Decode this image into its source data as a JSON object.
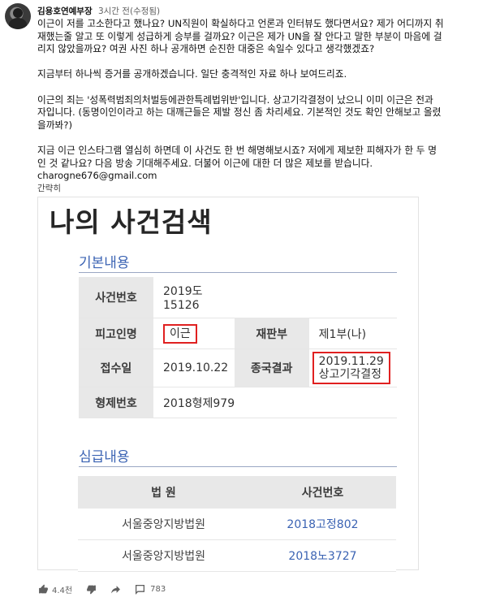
{
  "comment": {
    "author": "김용호연예부장",
    "time": "3시간 전(수정됨)",
    "paragraphs": [
      [
        "이근이 저를 고소한다고 했나요? UN직원이 확실하다고 언론과 인터뷰도 했다면서요? 제가 어디까지 취",
        "재했는줄 알고 또 이렇게 성급하게 승부를 걸까요? 이근은 제가 UN을 잘 안다고 말한 부분이 마음에 걸",
        "리지 않았을까요? 여권 사진 하나 공개하면 순진한 대중은 속일수 있다고 생각했겠죠?"
      ],
      [
        "지금부터 하나씩 증거를 공개하겠습니다. 일단 충격적인 자료 하나 보여드리죠."
      ],
      [
        "이근의 죄는 '성폭력범죄의처벌등에관한특례법위반'입니다. 상고기각결정이 났으니 이미 이근은 전과",
        "자입니다. (동명이인이라고 하는 대깨근들은 제발 정신 좀 차리세요. 기본적인 것도 확인 안해보고 올렸",
        "을까봐?)"
      ],
      [
        "지금 이근 인스타그램 열심히 하면데 이 사건도 한 번 해명해보시죠? 저에게 제보한 피해자가 한 두 명",
        "인 것 같나요? 다음 방송 기대해주세요. 더불어 이근에 대한 더 많은 제보를 받습니다."
      ]
    ],
    "email": "charogne676@gmail.com",
    "collapse_label": "간략히"
  },
  "case_search": {
    "title": "나의 사건검색",
    "basic_section": "기본내용",
    "case_number_label": "사건번호",
    "case_number_value_1": "2019도",
    "case_number_value_2": "15126",
    "defendant_label": "피고인명",
    "defendant_value": "이근",
    "division_label": "재판부",
    "division_value": "제1부(나)",
    "received_label": "접수일",
    "received_value": "2019.10.22",
    "final_result_label": "종국결과",
    "final_result_date": "2019.11.29",
    "final_result_value": "상고기각결정",
    "criminal_no_label": "형제번호",
    "criminal_no_value": "2018형제979",
    "lower_section": "심급내용",
    "court_header": "법 원",
    "case_header": "사건번호",
    "rows": [
      {
        "court": "서울중앙지방법원",
        "case": "2018고정802"
      },
      {
        "court": "서울중앙지방법원",
        "case": "2018노3727"
      }
    ]
  },
  "actions": {
    "like_count": "4.4천",
    "reply_count": "783",
    "icons": [
      "thumbs-up-icon",
      "thumbs-down-icon",
      "share-icon",
      "comment-icon"
    ]
  },
  "colors": {
    "accent_blue": "#3b63b3",
    "highlight_red": "#e02020"
  }
}
